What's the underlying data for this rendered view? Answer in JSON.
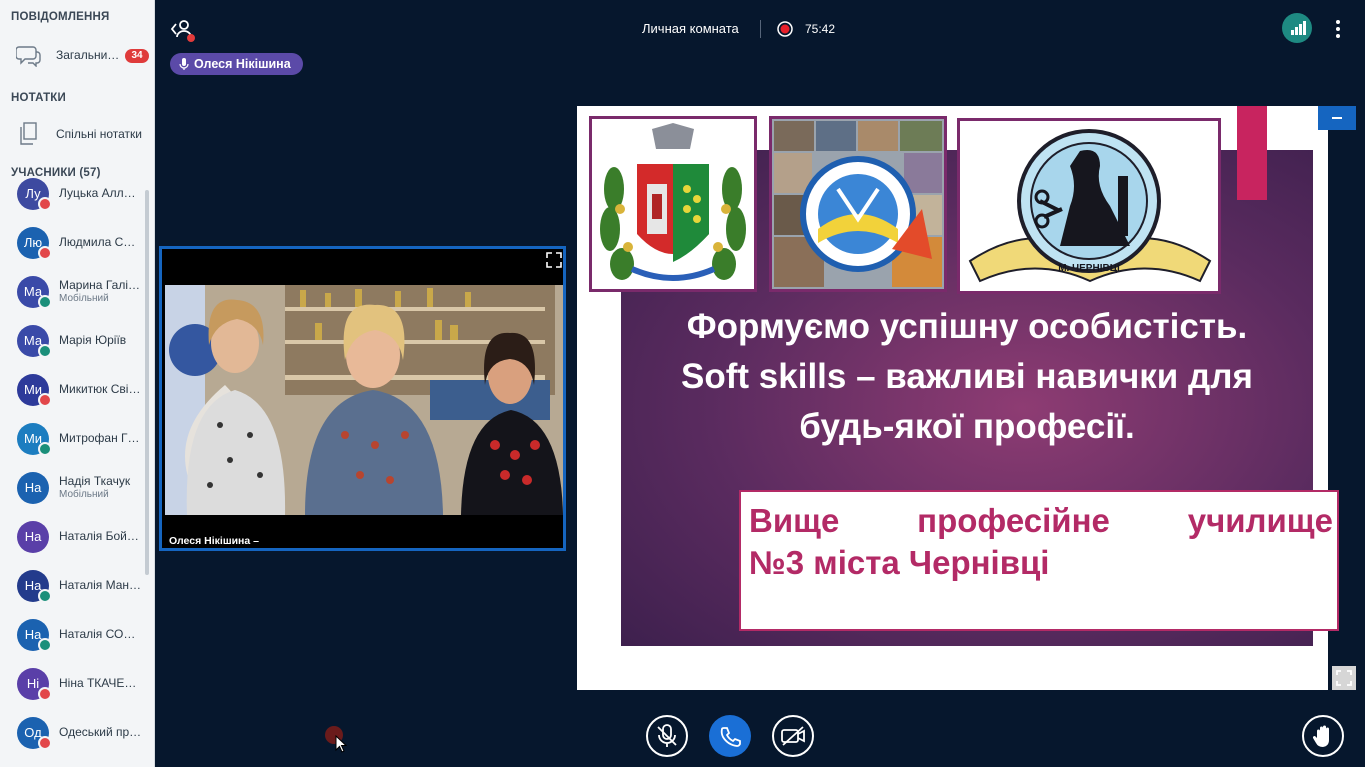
{
  "sidebar": {
    "messages_title": "ПОВІДОМЛЕННЯ",
    "general_chat": "Загальни…",
    "general_badge": "34",
    "notes_title": "НОТАТКИ",
    "shared_notes": "Спільні нотатки",
    "participants_title": "УЧАСНИКИ (57)",
    "users": [
      {
        "initials": "Лу",
        "name": "Луцька Алл…",
        "sub": "",
        "status": "r",
        "color": "#3d4aa0"
      },
      {
        "initials": "Лю",
        "name": "Людмила С…",
        "sub": "",
        "status": "r",
        "color": "#1b62b0"
      },
      {
        "initials": "Ма",
        "name": "Марина Галі…",
        "sub": "Мобільний",
        "status": "g",
        "color": "#3a4aa8"
      },
      {
        "initials": "Ма",
        "name": "Марія Юріїв",
        "sub": "",
        "status": "g",
        "color": "#3a4aa8"
      },
      {
        "initials": "Ми",
        "name": "Микитюк Сві…",
        "sub": "",
        "status": "r",
        "color": "#2d3a9a"
      },
      {
        "initials": "Ми",
        "name": "Митрофан Г…",
        "sub": "",
        "status": "g",
        "color": "#1c7dc0"
      },
      {
        "initials": "На",
        "name": "Надія Ткачук",
        "sub": "Мобільний",
        "status": "",
        "color": "#1b62b0"
      },
      {
        "initials": "На",
        "name": "Наталія Бой…",
        "sub": "",
        "status": "",
        "color": "#5a3fa8"
      },
      {
        "initials": "На",
        "name": "Наталія Ман…",
        "sub": "",
        "status": "g",
        "color": "#233b8c"
      },
      {
        "initials": "На",
        "name": "Наталія СО…",
        "sub": "",
        "status": "g",
        "color": "#1b62b0"
      },
      {
        "initials": "Ні",
        "name": "Ніна ТКАЧЕ…",
        "sub": "",
        "status": "r",
        "color": "#5a3fa8"
      },
      {
        "initials": "Од",
        "name": "Одеський пр…",
        "sub": "",
        "status": "r",
        "color": "#1b62b0"
      }
    ]
  },
  "topbar": {
    "room_title": "Личная комната",
    "timer": "75:42",
    "talker": "Олеся Нікішина"
  },
  "webcam": {
    "name": "Олеся Нікішина –"
  },
  "slide": {
    "headline_1": "Формуємо успішну особистість.",
    "headline_2": "Soft skills – важливі навички для",
    "headline_3": "будь-якої професії.",
    "sub_1": "Вище професійне училище",
    "sub_2": "№3 міста Чернівці",
    "logo_text": "М. ЧЕРНІВЦІ"
  },
  "colors": {
    "accent_blue": "#1565c0",
    "slide_purple": "#5a2b5f",
    "slide_pink": "#b32a66",
    "talker_bg": "#5b4aa8"
  }
}
